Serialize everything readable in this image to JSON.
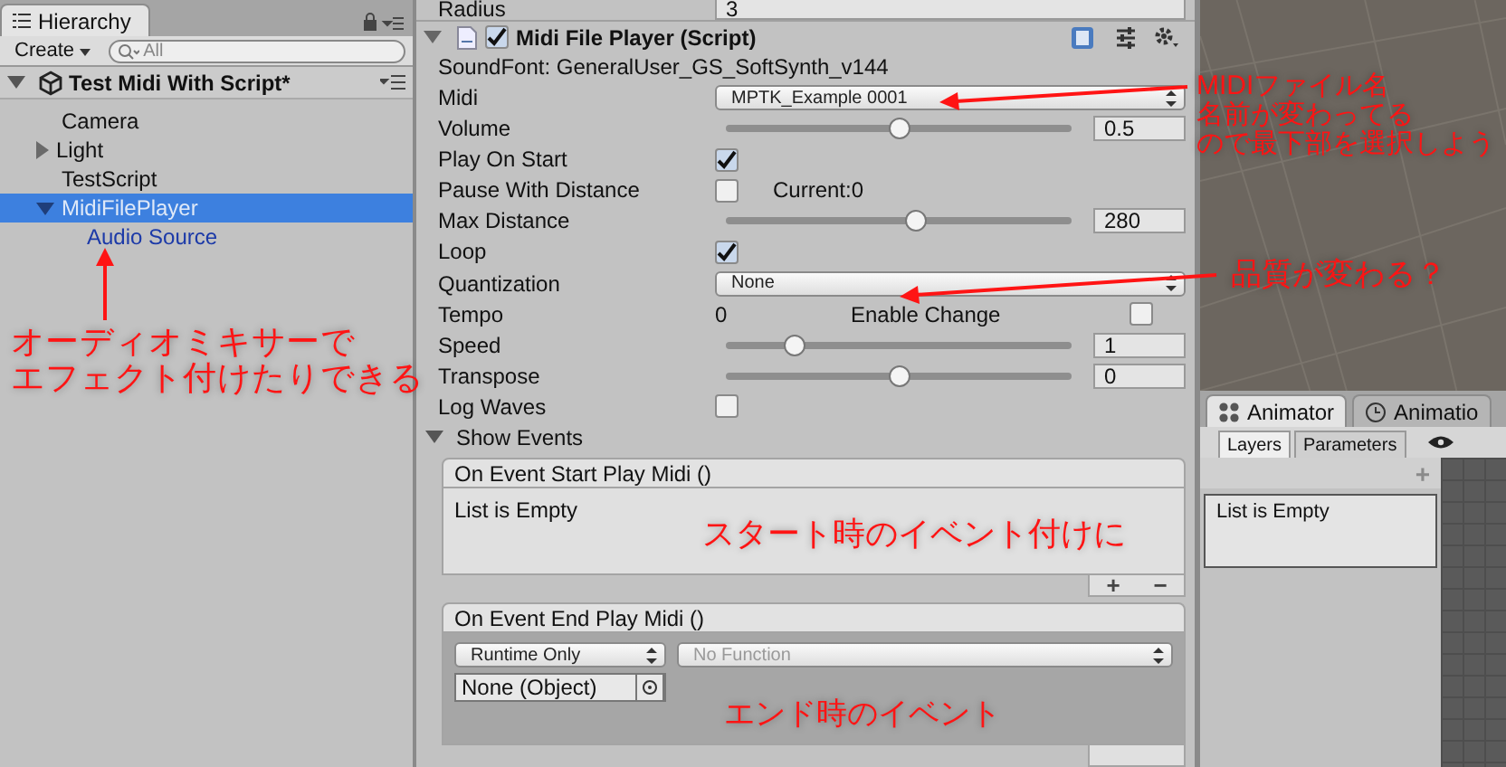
{
  "hierarchy": {
    "title": "Hierarchy",
    "create_button": "Create",
    "search": {
      "placeholder": "All"
    },
    "scene": {
      "name": "Test Midi With Script*",
      "expanded": true,
      "items": [
        {
          "label": "Camera",
          "selected": false,
          "prefab": false
        },
        {
          "label": "Light",
          "selected": false,
          "prefab": false,
          "expanded": false
        },
        {
          "label": "TestScript",
          "selected": false,
          "prefab": false
        },
        {
          "label": "MidiFilePlayer",
          "selected": true,
          "prefab": false,
          "expanded": true,
          "children": [
            {
              "label": "Audio Source",
              "selected": false,
              "prefab": true
            }
          ]
        }
      ]
    }
  },
  "inspector": {
    "previous_field": {
      "label": "Radius",
      "value": "3"
    },
    "component": {
      "title": "Midi File Player (Script)",
      "expanded": true,
      "enabled": true,
      "soundfont": "SoundFont: GeneralUser_GS_SoftSynth_v144",
      "properties": [
        {
          "kind": "popup",
          "label": "Midi",
          "value": "MPTK_Example 0001"
        },
        {
          "kind": "slider",
          "label": "Volume",
          "level": 0.5,
          "value": "0.5"
        },
        {
          "kind": "checkbox",
          "label": "Play On Start",
          "checked": true
        },
        {
          "kind": "checkbox",
          "label": "Pause With Distance",
          "checked": false,
          "note": "Current:0"
        },
        {
          "kind": "slider",
          "label": "Max Distance",
          "level": 0.55,
          "value": "280"
        },
        {
          "kind": "checkbox",
          "label": "Loop",
          "checked": true
        },
        {
          "kind": "popup",
          "label": "Quantization",
          "value": "None"
        },
        {
          "kind": "readout",
          "label": "Tempo",
          "value": "0",
          "toggle_label": "Enable Change",
          "checked": false
        },
        {
          "kind": "slider",
          "label": "Speed",
          "level": 0.2,
          "value": "1"
        },
        {
          "kind": "slider",
          "label": "Transpose",
          "level": 0.5,
          "value": "0"
        },
        {
          "kind": "checkbox",
          "label": "Log Waves",
          "checked": false
        }
      ],
      "show_events": {
        "label": "Show Events",
        "expanded": true
      },
      "events": [
        {
          "title": "On Event Start Play Midi ()",
          "empty_text": "List is Empty",
          "add_button": "+",
          "remove_button": "−"
        },
        {
          "title": "On Event End Play Midi ()",
          "listeners": [
            {
              "mode": "Runtime Only",
              "function": "No Function",
              "object": "None (Object)"
            }
          ]
        }
      ]
    }
  },
  "animator": {
    "tabs": [
      {
        "label": "Animator",
        "selected": true
      },
      {
        "label": "Animatio",
        "selected": false
      }
    ],
    "subtabs": [
      {
        "label": "Layers",
        "selected": true
      },
      {
        "label": "Parameters",
        "selected": false
      }
    ],
    "add_button": "+",
    "empty_text": "List is Empty"
  },
  "annotations": [
    {
      "kind": "midi",
      "lines": [
        "MIDIファイル名",
        "名前が変わってる",
        "ので最下部を選択しよう"
      ]
    },
    {
      "kind": "quality",
      "lines": [
        "品質が変わる？"
      ]
    },
    {
      "kind": "mixer",
      "lines": [
        "オーディオミキサーで",
        "エフェクト付けたりできる"
      ]
    },
    {
      "kind": "start",
      "lines": [
        "スタート時のイベント付けに"
      ]
    },
    {
      "kind": "end",
      "lines": [
        "エンド時のイベント"
      ]
    }
  ]
}
